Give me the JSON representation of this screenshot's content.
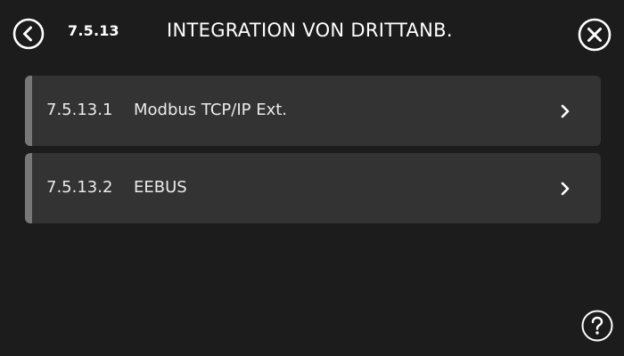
{
  "header": {
    "back_icon": "chevron-left-circle-icon",
    "code": "7.5.13",
    "title": "INTEGRATION VON DRITTANB.",
    "close_icon": "close-circle-icon"
  },
  "menu": {
    "items": [
      {
        "code": "7.5.13.1",
        "label": "Modbus TCP/IP Ext.",
        "icon": "chevron-right-icon"
      },
      {
        "code": "7.5.13.2",
        "label": "EEBUS",
        "icon": "chevron-right-icon"
      }
    ]
  },
  "footer": {
    "help_icon": "question-circle-icon"
  },
  "colors": {
    "background": "#1c1c1c",
    "item_background": "#333333",
    "item_accent": "#777777",
    "text": "#ffffff"
  }
}
